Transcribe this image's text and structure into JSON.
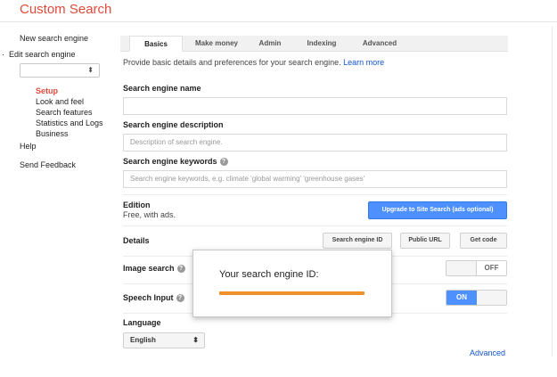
{
  "app": {
    "title": "Custom Search"
  },
  "sidebar": {
    "new_engine": "New search engine",
    "edit_bullet": "·",
    "edit_engine": "Edit search engine",
    "select_chevron": "⬍",
    "items": [
      {
        "label": "Setup",
        "active": true
      },
      {
        "label": "Look and feel",
        "active": false
      },
      {
        "label": "Search features",
        "active": false
      },
      {
        "label": "Statistics and Logs",
        "active": false
      },
      {
        "label": "Business",
        "active": false
      }
    ],
    "help": "Help",
    "feedback": "Send Feedback"
  },
  "tabs": [
    {
      "label": "Basics",
      "active": true
    },
    {
      "label": "Make money",
      "active": false
    },
    {
      "label": "Admin",
      "active": false
    },
    {
      "label": "Indexing",
      "active": false
    },
    {
      "label": "Advanced",
      "active": false
    }
  ],
  "intro": {
    "text": "Provide basic details and preferences for your search engine.",
    "learn_more": "Learn more"
  },
  "fields": {
    "name_label": "Search engine name",
    "name_value": "",
    "description_label": "Search engine description",
    "description_placeholder": "Description of search engine.",
    "keywords_label": "Search engine keywords",
    "keywords_placeholder": "Search engine keywords, e.g. climate 'global warming' 'greenhouse gases'"
  },
  "edition": {
    "label": "Edition",
    "value": "Free, with ads.",
    "upgrade_button": "Upgrade to Site Search (ads optional)"
  },
  "details": {
    "label": "Details",
    "engine_id_button": "Search engine ID",
    "public_url_button": "Public URL",
    "get_code_button": "Get code"
  },
  "image_search": {
    "label": "Image search",
    "state": "OFF"
  },
  "speech_input": {
    "label": "Speech Input",
    "state": "ON"
  },
  "language": {
    "label": "Language",
    "selected": "English",
    "chevron": "⬍"
  },
  "advanced_link": "Advanced",
  "popup": {
    "title": "Your search engine ID:"
  },
  "icons": {
    "help": "?"
  },
  "colors": {
    "brand": "#dd4b39",
    "accent": "#4d90fe",
    "link": "#1155cc",
    "redaction": "#f0902b"
  }
}
